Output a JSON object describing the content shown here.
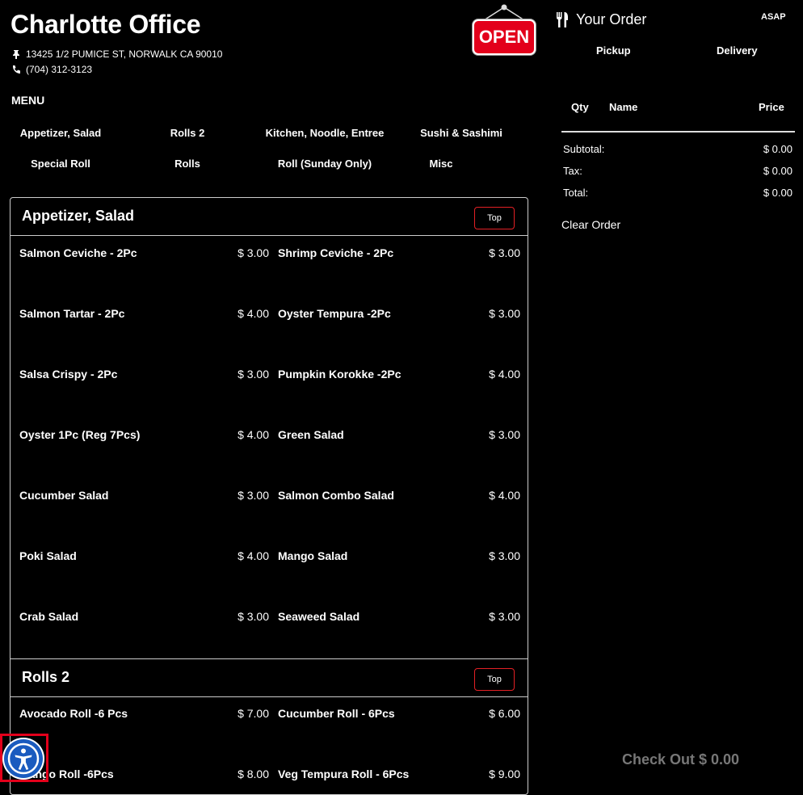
{
  "store": {
    "name": "Charlotte Office",
    "address": "13425 1/2 PUMICE ST, NORWALK CA 90010",
    "phone": "(704) 312-3123",
    "status_sign": "OPEN"
  },
  "menu_label": "MENU",
  "categories": [
    "Appetizer, Salad",
    "Rolls 2",
    "Kitchen, Noodle, Entree",
    "Sushi & Sashimi",
    "Special Roll",
    "Rolls",
    "Roll (Sunday Only)",
    "Misc"
  ],
  "sections": [
    {
      "title": "Appetizer, Salad",
      "top_label": "Top",
      "items": [
        {
          "name": "Salmon Ceviche - 2Pc",
          "price": "$ 3.00"
        },
        {
          "name": "Shrimp Ceviche - 2Pc",
          "price": "$ 3.00"
        },
        {
          "name": "Salmon Tartar - 2Pc",
          "price": "$ 4.00"
        },
        {
          "name": "Oyster Tempura -2Pc",
          "price": "$ 3.00"
        },
        {
          "name": "Salsa Crispy - 2Pc",
          "price": "$ 3.00"
        },
        {
          "name": "Pumpkin Korokke -2Pc",
          "price": "$ 4.00"
        },
        {
          "name": "Oyster 1Pc (Reg 7Pcs)",
          "price": "$ 4.00"
        },
        {
          "name": "Green Salad",
          "price": "$ 3.00"
        },
        {
          "name": "Cucumber Salad",
          "price": "$ 3.00"
        },
        {
          "name": "Salmon Combo Salad",
          "price": "$ 4.00"
        },
        {
          "name": "Poki Salad",
          "price": "$ 4.00"
        },
        {
          "name": "Mango Salad",
          "price": "$ 3.00"
        },
        {
          "name": "Crab Salad",
          "price": "$ 3.00"
        },
        {
          "name": "Seaweed Salad",
          "price": "$ 3.00"
        }
      ]
    },
    {
      "title": "Rolls 2",
      "top_label": "Top",
      "items": [
        {
          "name": "Avocado Roll -6 Pcs",
          "price": "$ 7.00"
        },
        {
          "name": "Cucumber Roll - 6Pcs",
          "price": "$ 6.00"
        },
        {
          "name": "Mango Roll -6Pcs",
          "price": "$ 8.00"
        },
        {
          "name": "Veg Tempura Roll - 6Pcs",
          "price": "$ 9.00"
        }
      ]
    }
  ],
  "order": {
    "title": "Your Order",
    "asap": "ASAP",
    "modes": [
      "Pickup",
      "Delivery"
    ],
    "columns": [
      "Qty",
      "Name",
      "Price"
    ],
    "summary": [
      {
        "label": "Subtotal:",
        "value": "$ 0.00"
      },
      {
        "label": "Tax:",
        "value": "$ 0.00"
      },
      {
        "label": "Total:",
        "value": "$ 0.00"
      }
    ],
    "clear_label": "Clear Order",
    "checkout_label": "Check Out $ 0.00"
  },
  "icons": {
    "pin": "pushpin-icon",
    "phone": "phone-icon",
    "utensils": "utensils-icon",
    "accessibility": "accessibility-icon"
  },
  "colors": {
    "background": "#000000",
    "accent_red": "#e32025",
    "open_sign": "#e3001b",
    "accessibility_blue": "#1a5bbf",
    "checkout_disabled": "#777777"
  }
}
